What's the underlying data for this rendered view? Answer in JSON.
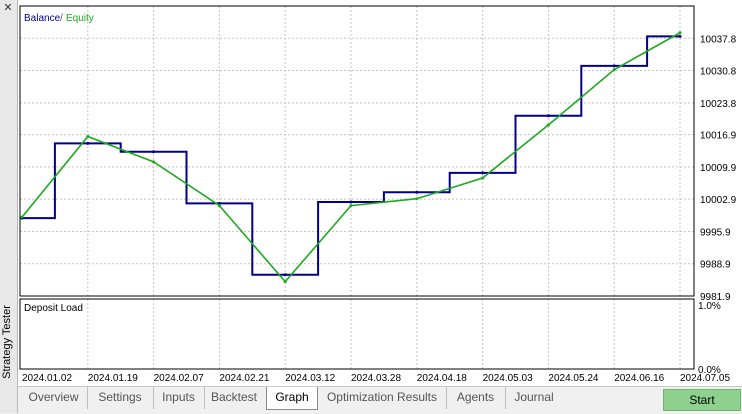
{
  "window": {
    "side_title": "Strategy Tester"
  },
  "legend": {
    "balance": "Balance",
    "separator": "/",
    "equity": "Equity"
  },
  "colors": {
    "balance": "#00008b",
    "equity": "#1ea81e",
    "grid": "#c4c4c4",
    "frame": "#000000"
  },
  "main_pane": {
    "y_ticks": [
      "10037.8",
      "10030.8",
      "10023.8",
      "10016.9",
      "10009.9",
      "10002.9",
      "9995.9",
      "9988.9",
      "9981.9"
    ],
    "y_range": [
      9981.9,
      10044.8
    ]
  },
  "deposit_pane": {
    "title": "Deposit Load",
    "y_top": "1.0%",
    "y_bottom": "0.0%"
  },
  "x_ticks": [
    "2024.01.02",
    "2024.01.19",
    "2024.02.07",
    "2024.02.21",
    "2024.03.12",
    "2024.03.28",
    "2024.04.18",
    "2024.05.03",
    "2024.05.24",
    "2024.06.16",
    "2024.07.05"
  ],
  "chart_data": {
    "type": "line",
    "x": [
      "2024.01.02",
      "2024.01.19",
      "2024.02.07",
      "2024.02.21",
      "2024.03.12",
      "2024.03.28",
      "2024.04.18",
      "2024.05.03",
      "2024.05.24",
      "2024.06.16",
      "2024.07.05"
    ],
    "series": [
      {
        "name": "Balance",
        "color": "#00008b",
        "values": [
          9998.8,
          10015.0,
          10013.2,
          10002.0,
          9986.5,
          10002.3,
          10004.4,
          10008.6,
          10021.0,
          10031.8,
          10038.2
        ]
      },
      {
        "name": "Equity",
        "color": "#1ea81e",
        "values": [
          9999.0,
          10016.5,
          10011.0,
          10001.5,
          9985.0,
          10001.5,
          10003.0,
          10007.5,
          10019.0,
          10031.0,
          10039.0
        ]
      }
    ],
    "ylim": [
      9981.9,
      10044.8
    ],
    "grid": true,
    "legend": "top-left",
    "subplot": {
      "title": "Deposit Load",
      "ylim_labels": [
        "0.0%",
        "1.0%"
      ]
    }
  },
  "tabs": [
    {
      "label": "Overview"
    },
    {
      "label": "Settings"
    },
    {
      "label": "Inputs"
    },
    {
      "label": "Backtest"
    },
    {
      "label": "Graph"
    },
    {
      "label": "Optimization Results"
    },
    {
      "label": "Agents"
    },
    {
      "label": "Journal"
    }
  ],
  "start_button": "Start"
}
